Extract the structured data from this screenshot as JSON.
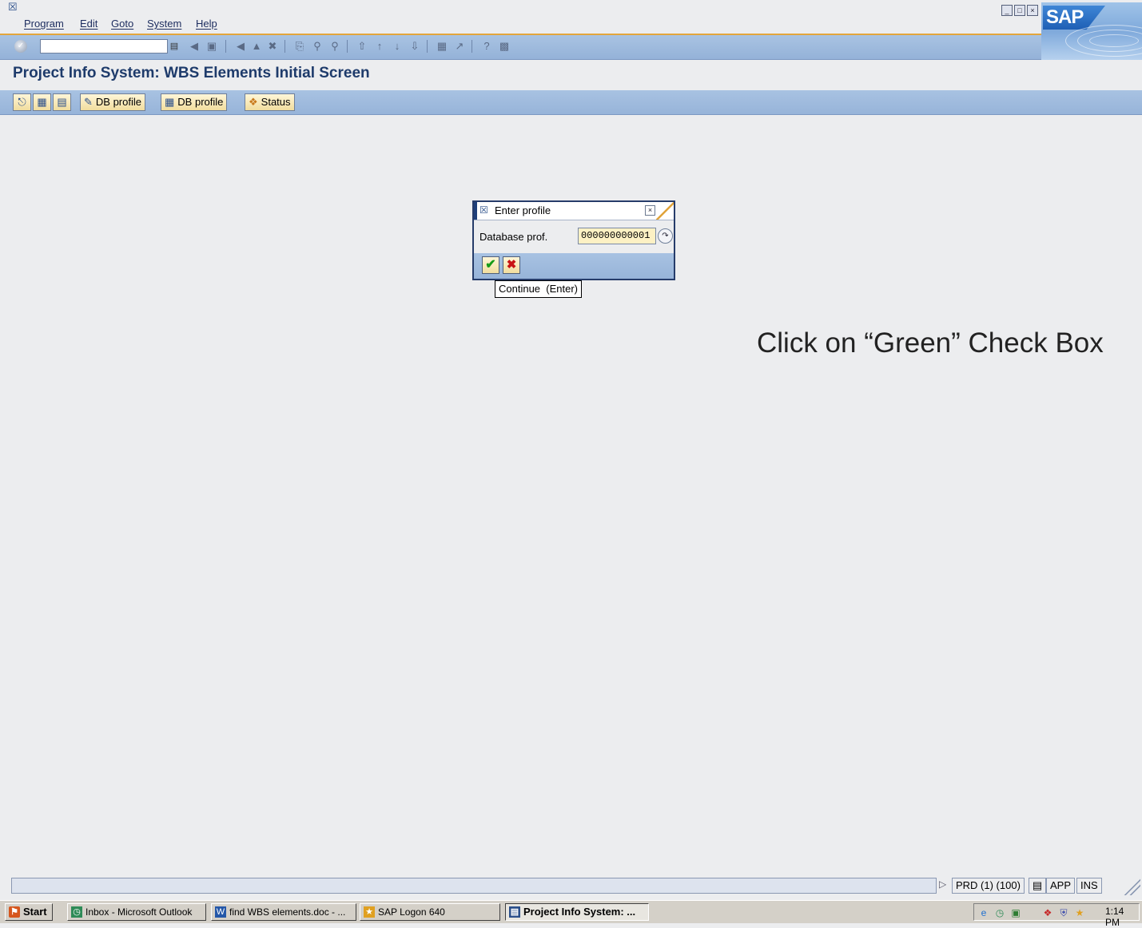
{
  "window": {
    "menu": [
      "Program",
      "Edit",
      "Goto",
      "System",
      "Help"
    ],
    "logo_text": "SAP"
  },
  "system_toolbar": {
    "command_value": "",
    "icons": [
      "enter-icon",
      "back-icon",
      "save-icon",
      "exit-icon",
      "cancel-icon",
      "stop-icon",
      "print-icon",
      "find-icon",
      "find-next-icon",
      "first-page-icon",
      "previous-page-icon",
      "next-page-icon",
      "last-page-icon",
      "create-session-icon",
      "shortcut-icon",
      "help-icon",
      "layout-menu-icon"
    ]
  },
  "title": "Project Info System: WBS Elements Initial Screen",
  "app_toolbar": {
    "buttons": [
      {
        "label": "",
        "icon": "execute-icon"
      },
      {
        "label": "",
        "icon": "open-project-icon"
      },
      {
        "label": "",
        "icon": "display-icon"
      },
      {
        "label": "DB profile",
        "icon": "edit-icon"
      },
      {
        "label": "DB profile",
        "icon": "db-profile-icon"
      },
      {
        "label": "Status",
        "icon": "status-icon"
      }
    ]
  },
  "dialog": {
    "title": "Enter profile",
    "field_label": "Database prof.",
    "field_value": "000000000001",
    "continue_icon": "checkmark-icon",
    "cancel_icon": "cancel-x-icon",
    "tooltip": "Continue  (Enter)"
  },
  "instruction": "Click on “Green” Check Box",
  "status_bar": {
    "message": "",
    "system": "PRD (1) (100)",
    "server": "APP",
    "mode": "INS"
  },
  "taskbar": {
    "start": "Start",
    "items": [
      {
        "label": "Inbox - Microsoft Outlook",
        "active": false
      },
      {
        "label": "find WBS elements.doc - ...",
        "active": false
      },
      {
        "label": "SAP Logon 640",
        "active": false
      },
      {
        "label": "Project Info System: ...",
        "active": true
      }
    ],
    "clock": "1:14 PM"
  }
}
